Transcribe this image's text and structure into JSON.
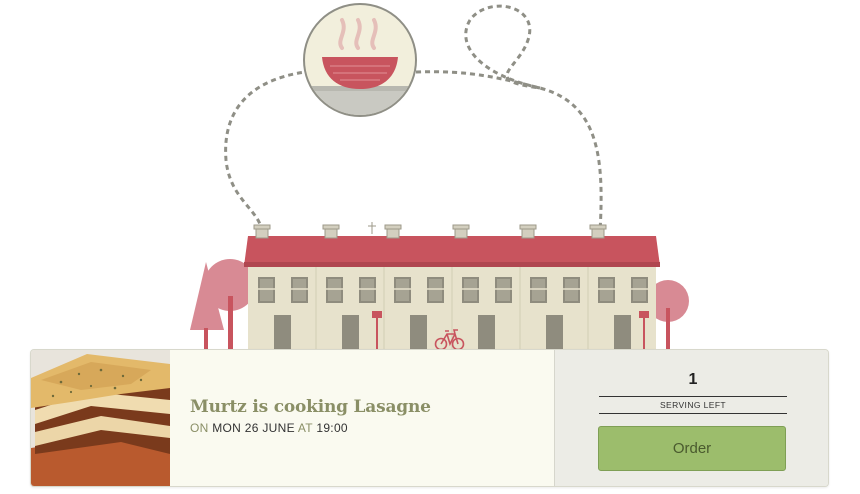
{
  "colors": {
    "roof": "#c8545e",
    "facade": "#e7e2cc",
    "tree": "#d88a94",
    "order_button": "#9cbd6c",
    "headline": "#8a8f66",
    "dashed_path": "#8f8f86"
  },
  "illustration": {
    "bowl_icon": "soup-bowl-icon",
    "bike_icon": "bicycle-icon"
  },
  "meal": {
    "headline": "Murtz is cooking Lasagne",
    "on_label": "ON",
    "date": "MON 26 JUNE",
    "at_label": "AT",
    "time": "19:00"
  },
  "order": {
    "servings_count": "1",
    "servings_label": "SERVING LEFT",
    "button_label": "Order"
  }
}
